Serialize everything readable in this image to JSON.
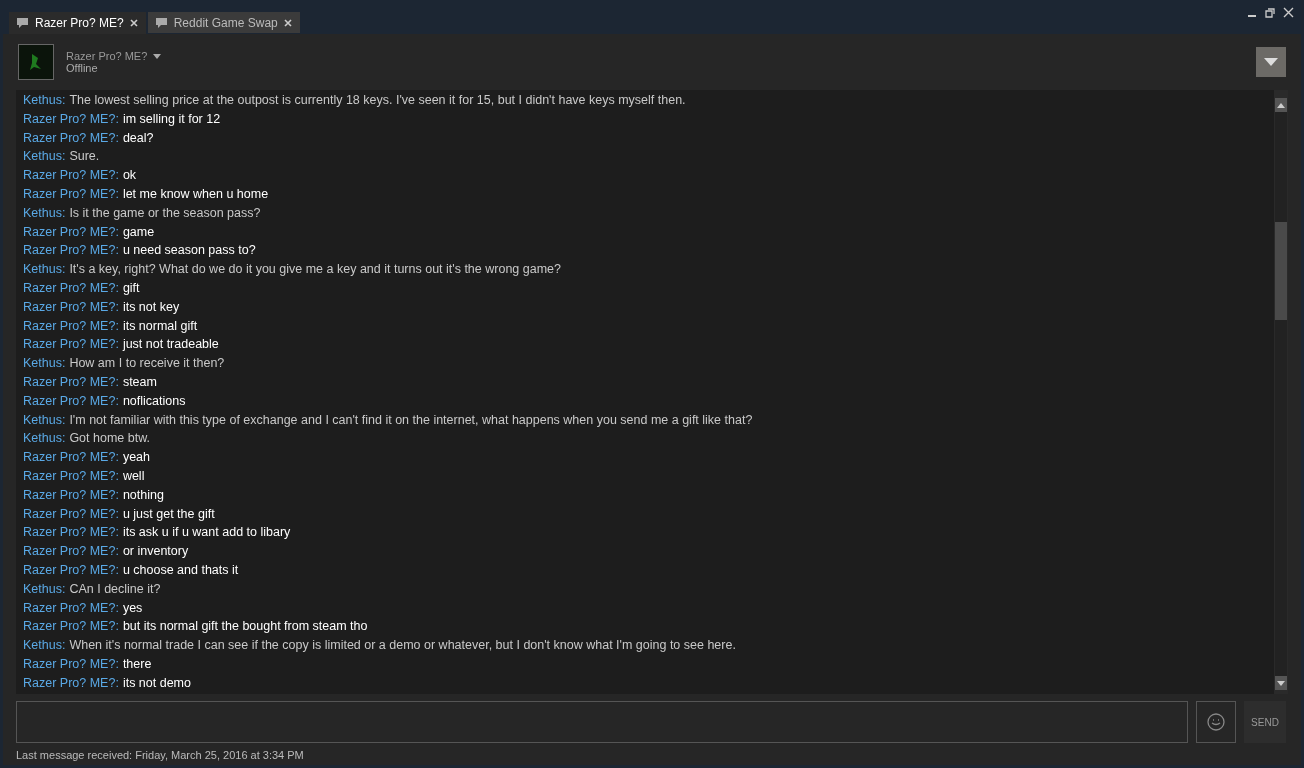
{
  "tabs": [
    {
      "label": "Razer Pro? ME?",
      "selected": true
    },
    {
      "label": "Reddit Game Swap",
      "selected": false
    }
  ],
  "contact": {
    "name": "Razer Pro? ME?",
    "status": "Offline"
  },
  "messages": [
    {
      "kind": "other",
      "speaker": "Kethus:",
      "text": "The lowest selling price at the outpost is currently 18 keys. I've seen it for 15, but I didn't have keys myself then."
    },
    {
      "kind": "self",
      "speaker": "Razer Pro? ME?:",
      "text": "im selling it for 12"
    },
    {
      "kind": "self",
      "speaker": "Razer Pro? ME?:",
      "text": "deal?"
    },
    {
      "kind": "other",
      "speaker": "Kethus:",
      "text": "Sure."
    },
    {
      "kind": "self",
      "speaker": "Razer Pro? ME?:",
      "text": "ok"
    },
    {
      "kind": "self",
      "speaker": "Razer Pro? ME?:",
      "text": "let me know when u home"
    },
    {
      "kind": "other",
      "speaker": "Kethus:",
      "text": "Is it the game or the season pass?"
    },
    {
      "kind": "self",
      "speaker": "Razer Pro? ME?:",
      "text": "game"
    },
    {
      "kind": "self",
      "speaker": "Razer Pro? ME?:",
      "text": "u need season pass to?"
    },
    {
      "kind": "other",
      "speaker": "Kethus:",
      "text": "It's a key, right? What do we do it you give me a key and it turns out it's the wrong game?"
    },
    {
      "kind": "self",
      "speaker": "Razer Pro? ME?:",
      "text": "gift"
    },
    {
      "kind": "self",
      "speaker": "Razer Pro? ME?:",
      "text": "its not key"
    },
    {
      "kind": "self",
      "speaker": "Razer Pro? ME?:",
      "text": "its normal gift"
    },
    {
      "kind": "self",
      "speaker": "Razer Pro? ME?:",
      "text": "just not tradeable"
    },
    {
      "kind": "other",
      "speaker": "Kethus:",
      "text": "How am I to receive it then?"
    },
    {
      "kind": "self",
      "speaker": "Razer Pro? ME?:",
      "text": "steam"
    },
    {
      "kind": "self",
      "speaker": "Razer Pro? ME?:",
      "text": "noflications"
    },
    {
      "kind": "other",
      "speaker": "Kethus:",
      "text": "I'm not familiar with this type of exchange and I can't find it on the internet, what happens when you send me a gift like that?"
    },
    {
      "kind": "other",
      "speaker": "Kethus:",
      "text": "Got home btw."
    },
    {
      "kind": "self",
      "speaker": "Razer Pro? ME?:",
      "text": "yeah"
    },
    {
      "kind": "self",
      "speaker": "Razer Pro? ME?:",
      "text": "well"
    },
    {
      "kind": "self",
      "speaker": "Razer Pro? ME?:",
      "text": "nothing"
    },
    {
      "kind": "self",
      "speaker": "Razer Pro? ME?:",
      "text": "u just get the gift"
    },
    {
      "kind": "self",
      "speaker": "Razer Pro? ME?:",
      "text": "its ask u if u want add to libary"
    },
    {
      "kind": "self",
      "speaker": "Razer Pro? ME?:",
      "text": "or inventory"
    },
    {
      "kind": "self",
      "speaker": "Razer Pro? ME?:",
      "text": "u choose and thats it"
    },
    {
      "kind": "other",
      "speaker": "Kethus:",
      "text": "CAn I decline it?"
    },
    {
      "kind": "self",
      "speaker": "Razer Pro? ME?:",
      "text": "yes"
    },
    {
      "kind": "self",
      "speaker": "Razer Pro? ME?:",
      "text": "but its normal gift the bought from steam tho"
    },
    {
      "kind": "other",
      "speaker": "Kethus:",
      "text": "When it's normal trade I can see if the copy is limited or a demo or whatever, but I don't know what I'm going to see here."
    },
    {
      "kind": "self",
      "speaker": "Razer Pro? ME?:",
      "text": "there"
    },
    {
      "kind": "self",
      "speaker": "Razer Pro? ME?:",
      "text": "its not demo"
    }
  ],
  "send_button": "SEND",
  "status_bar": "Last message received: Friday, March 25, 2016 at 3:34 PM"
}
